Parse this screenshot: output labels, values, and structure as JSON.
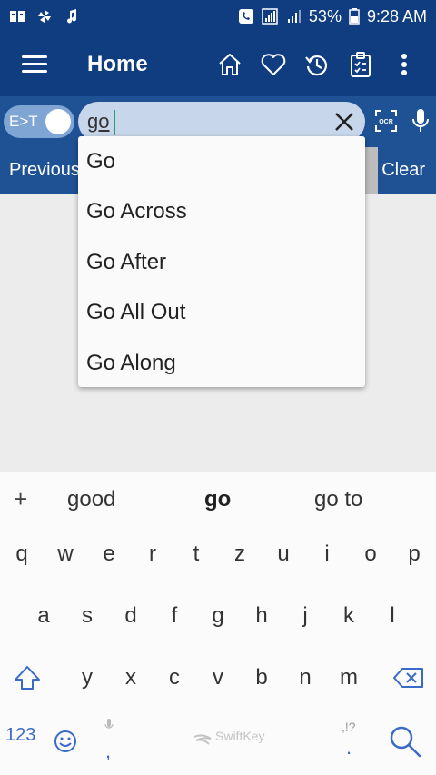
{
  "status_bar": {
    "battery": "53%",
    "time": "9:28 AM"
  },
  "app_bar": {
    "title": "Home",
    "icons": [
      "home-icon",
      "heart-icon",
      "history-icon",
      "clipboard-icon",
      "more-icon"
    ]
  },
  "search_row": {
    "toggle_label": "E>T",
    "search_value": "go",
    "ocr_label": "OCR"
  },
  "nav_row": {
    "previous_label": "Previous",
    "clear_label": "Clear"
  },
  "dropdown": {
    "items": [
      "Go",
      "Go Across",
      "Go After",
      "Go All Out",
      "Go Along"
    ]
  },
  "keyboard": {
    "suggestions": [
      "good",
      "go",
      "go to"
    ],
    "plus": "+",
    "row1": [
      "q",
      "w",
      "e",
      "r",
      "t",
      "z",
      "u",
      "i",
      "o",
      "p"
    ],
    "row2": [
      "a",
      "s",
      "d",
      "f",
      "g",
      "h",
      "j",
      "k",
      "l"
    ],
    "row3": [
      "y",
      "x",
      "c",
      "v",
      "b",
      "n",
      "m"
    ],
    "numbers_label": "123",
    "comma": ",",
    "brand": "SwiftKey",
    "period": ".",
    "punct_hint": ",!?"
  },
  "colors": {
    "primary": "#0f3d80",
    "secondary": "#1e5295",
    "accent": "#3a6ac8"
  }
}
